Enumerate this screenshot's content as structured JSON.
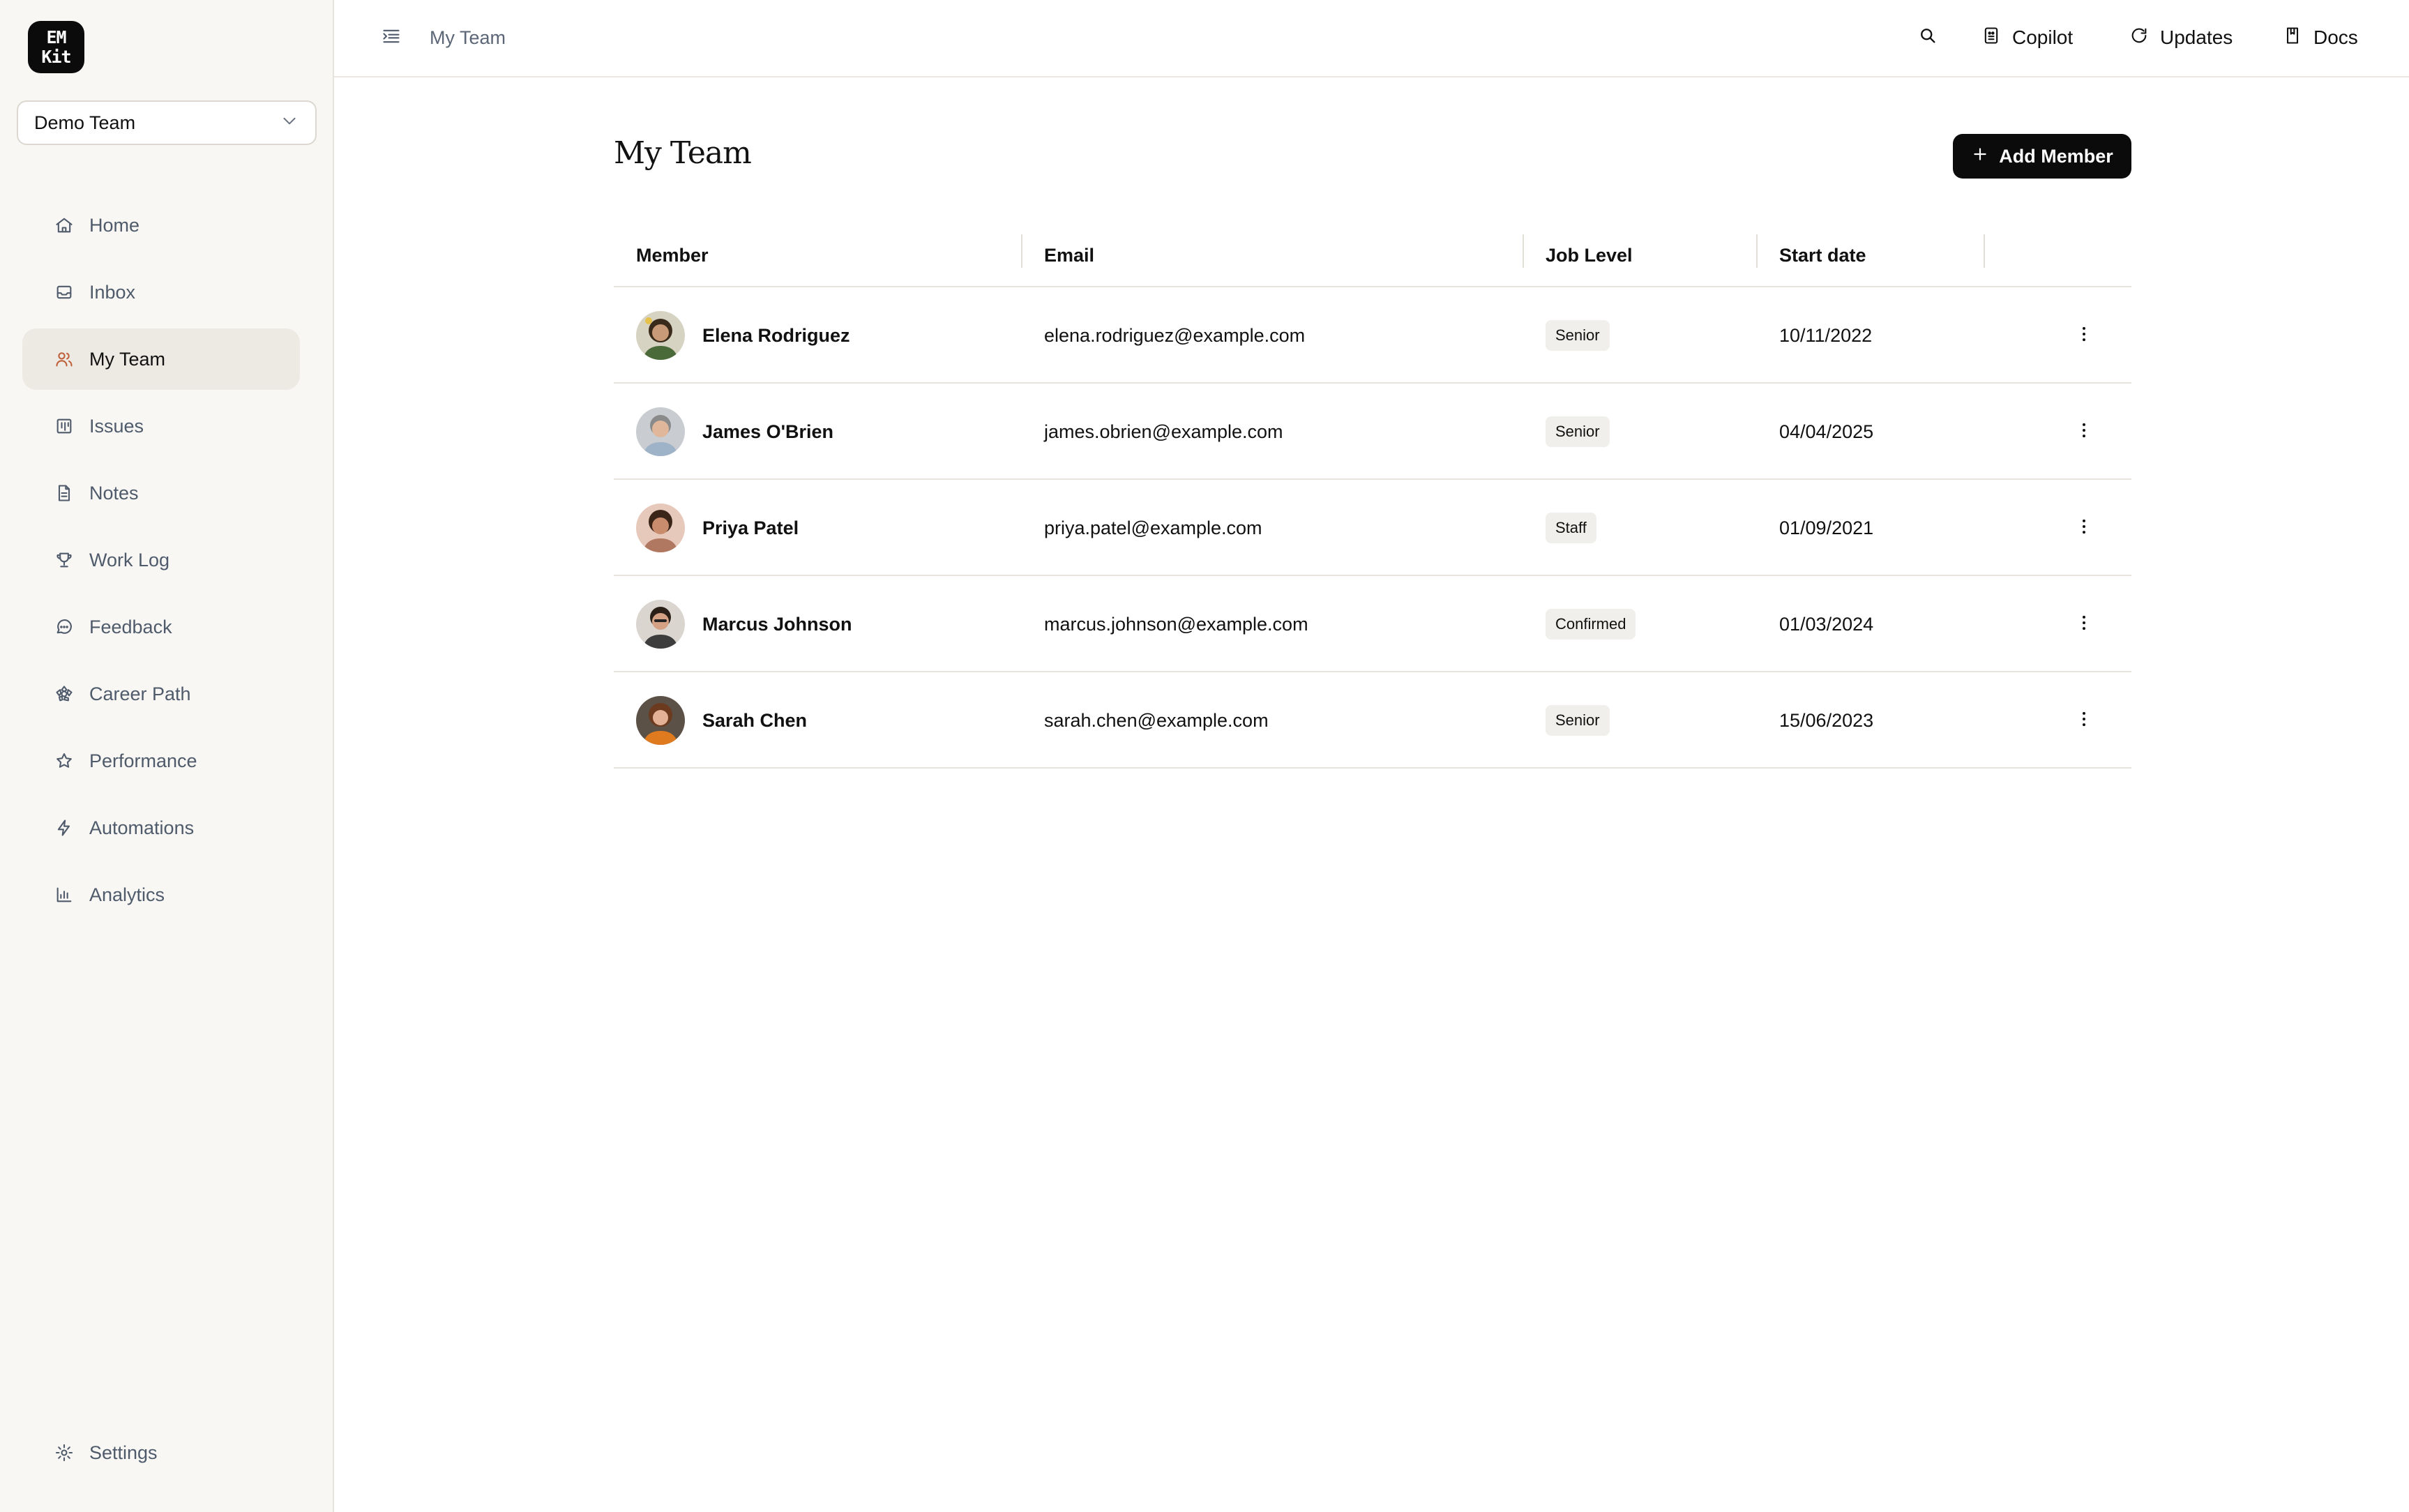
{
  "app": {
    "logo_line1": "EM",
    "logo_line2": "Kit"
  },
  "sidebar": {
    "team_selector": "Demo Team",
    "items": [
      {
        "label": "Home",
        "icon": "home-icon"
      },
      {
        "label": "Inbox",
        "icon": "inbox-icon"
      },
      {
        "label": "My Team",
        "icon": "users-icon",
        "active": true
      },
      {
        "label": "Issues",
        "icon": "kanban-icon"
      },
      {
        "label": "Notes",
        "icon": "file-text-icon"
      },
      {
        "label": "Work Log",
        "icon": "trophy-icon"
      },
      {
        "label": "Feedback",
        "icon": "message-circle-icon"
      },
      {
        "label": "Career Path",
        "icon": "flower-icon"
      },
      {
        "label": "Performance",
        "icon": "star-icon"
      },
      {
        "label": "Automations",
        "icon": "zap-icon"
      },
      {
        "label": "Analytics",
        "icon": "bar-chart-icon"
      }
    ],
    "settings_label": "Settings"
  },
  "topbar": {
    "breadcrumb": "My Team",
    "copilot_label": "Copilot",
    "updates_label": "Updates",
    "docs_label": "Docs"
  },
  "main": {
    "title": "My Team",
    "add_member_label": "Add Member",
    "columns": {
      "member": "Member",
      "email": "Email",
      "job_level": "Job Level",
      "start_date": "Start date"
    },
    "rows": [
      {
        "name": "Elena Rodriguez",
        "email": "elena.rodriguez@example.com",
        "level": "Senior",
        "start": "10/11/2022"
      },
      {
        "name": "James O'Brien",
        "email": "james.obrien@example.com",
        "level": "Senior",
        "start": "04/04/2025"
      },
      {
        "name": "Priya Patel",
        "email": "priya.patel@example.com",
        "level": "Staff",
        "start": "01/09/2021"
      },
      {
        "name": "Marcus Johnson",
        "email": "marcus.johnson@example.com",
        "level": "Confirmed",
        "start": "01/03/2024"
      },
      {
        "name": "Sarah Chen",
        "email": "sarah.chen@example.com",
        "level": "Senior",
        "start": "15/06/2023"
      }
    ]
  },
  "colors": {
    "sidebar_bg": "#f8f7f4",
    "active_item_bg": "#ede9e3",
    "accent": "#0b0b0b",
    "active_icon": "#c0603a"
  }
}
